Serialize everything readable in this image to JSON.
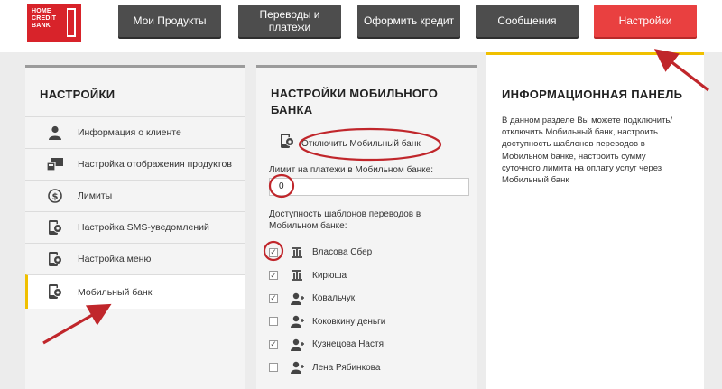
{
  "logo": {
    "line1": "HOME",
    "line2": "CREDIT",
    "line3": "BANK"
  },
  "nav": {
    "products": "Мои Продукты",
    "transfers_l1": "Переводы и",
    "transfers_l2": "платежи",
    "credit": "Оформить кредит",
    "messages": "Сообщения",
    "settings": "Настройки"
  },
  "left": {
    "title": "НАСТРОЙКИ",
    "items": [
      {
        "label": "Информация о клиенте",
        "icon": "user-icon"
      },
      {
        "label": "Настройка отображения продуктов",
        "icon": "display-products-icon"
      },
      {
        "label": "Лимиты",
        "icon": "dollar-icon"
      },
      {
        "label": "Настройка SMS-уведомлений",
        "icon": "phone-gear-icon"
      },
      {
        "label": "Настройка меню",
        "icon": "phone-gear-icon"
      },
      {
        "label": "Мобильный банк",
        "icon": "phone-gear-icon"
      }
    ]
  },
  "mid": {
    "title_l1": "НАСТРОЙКИ МОБИЛЬНОГО",
    "title_l2": "БАНКА",
    "disable_label": "Отключить Мобильный банк",
    "limit_label": "Лимит на платежи в Мобильном банке:",
    "limit_value": "0",
    "templates_label": "Доступность шаблонов переводов в Мобильном банке:",
    "templates": [
      {
        "name": "Власова Сбер",
        "checked": true,
        "icon": "bank-icon"
      },
      {
        "name": "Кирюша",
        "checked": true,
        "icon": "bank-icon"
      },
      {
        "name": "Ковальчук",
        "checked": true,
        "icon": "person-transfer-icon"
      },
      {
        "name": "Коковкину деньги",
        "checked": false,
        "icon": "person-transfer-icon"
      },
      {
        "name": "Кузнецова Настя",
        "checked": true,
        "icon": "person-transfer-icon"
      },
      {
        "name": "Лена Рябинкова",
        "checked": false,
        "icon": "person-transfer-icon"
      }
    ]
  },
  "right": {
    "title": "ИНФОРМАЦИОННАЯ ПАНЕЛЬ",
    "lines": [
      "В данном разделе Вы можете подключить/",
      "отключить Мобильный банк, настроить",
      "доступность шаблонов переводов в",
      "Мобильном банке, настроить сумму",
      "суточного лимита на оплату услуг через",
      "Мобильный банк"
    ]
  },
  "colors": {
    "accent_red": "#e94040",
    "nav_dark": "#4d4d4d",
    "highlight_yellow": "#f0c000",
    "annotation_red": "#c0262b"
  }
}
